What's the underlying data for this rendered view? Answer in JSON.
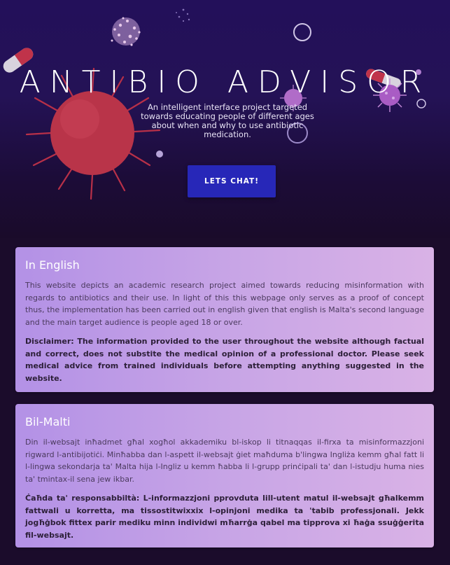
{
  "hero": {
    "title": "ANTIBIO ADVISOR",
    "subtitle": "An intelligent interface project targeted towards educating people of different ages about when and why to use antibiotic medication.",
    "cta_label": "LETS CHAT!"
  },
  "sections": [
    {
      "heading": "In English",
      "body": "This website depicts an academic research project aimed towards reducing misinformation with regards to antibiotics and their use. In light of this this webpage only serves as a proof of concept thus, the implementation has been carried out in english given that english is Malta's second language and the main target audience is people aged 18 or over.",
      "disclaimer": "Disclaimer: The information provided to the user throughout the website although factual and correct, does not substite the medical opinion of a professional doctor. Please seek medical advice from trained individuals before attempting anything suggested in the website."
    },
    {
      "heading": "Bil-Malti",
      "body": "Din il-websajt inħadmet għal xogħol akkademiku bl-iskop li titnaqqas il-firxa ta misinformazzjoni rigward l-antibijotiċi. Minħabba dan l-aspett il-websajt ġiet maħduma b'lingwa Ingliża kemm għal fatt li l-lingwa sekondarja ta' Malta hija l-Ingliz u kemm ħabba li l-grupp prinċipali ta' dan l-istudju huma nies ta' tmintax-il sena jew ikbar.",
      "disclaimer": "Ċaħda ta' responsabbiltà: L-informazzjoni pprovduta lill-utent matul il-websajt għalkemm fattwali u korretta, ma tissostitwixxix l-opinjoni medika ta 'tabib professjonali. Jekk jogħġbok fittex parir mediku minn individwi mħarrġa qabel ma tipprova xi ħaġa ssuġġerita fil-websajt."
    }
  ]
}
